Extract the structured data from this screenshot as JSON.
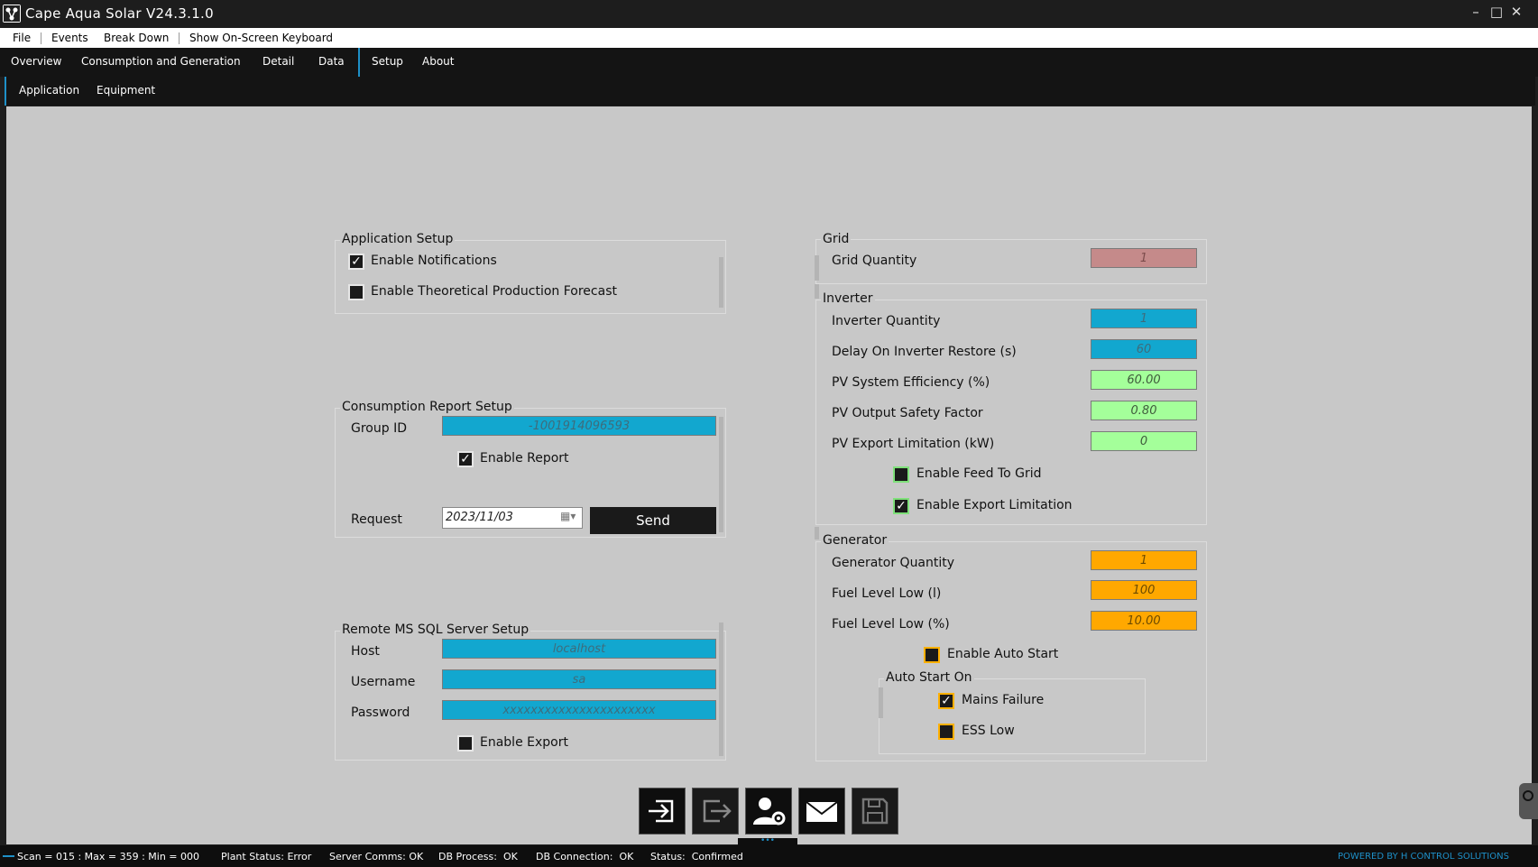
{
  "window": {
    "title": "Cape Aqua Solar V24.3.1.0",
    "minimize": "–",
    "maximize": "□",
    "close": "✕"
  },
  "menu": [
    "File",
    "Events",
    "Break Down",
    "Show On-Screen Keyboard"
  ],
  "tabs": [
    "Overview",
    "Consumption and Generation",
    "Detail",
    "Data",
    "Setup",
    "About"
  ],
  "active_tab": "Setup",
  "subtabs": [
    "Application",
    "Equipment"
  ],
  "application_setup": {
    "title": "Application Setup",
    "enable_notifications": "Enable Notifications",
    "enable_notifications_checked": true,
    "enable_forecast": "Enable Theoretical Production Forecast",
    "enable_forecast_checked": false
  },
  "consumption_report": {
    "title": "Consumption Report Setup",
    "group_id_label": "Group ID",
    "group_id_value": "-1001914096593",
    "enable_report": "Enable Report",
    "enable_report_checked": true,
    "request_label": "Request",
    "request_date": "2023/11/03",
    "send_label": "Send"
  },
  "sql_server": {
    "title": "Remote MS SQL Server Setup",
    "host_label": "Host",
    "host_value": "localhost",
    "username_label": "Username",
    "username_value": "sa",
    "password_label": "Password",
    "password_value": "xxxxxxxxxxxxxxxxxxxxxx",
    "enable_export": "Enable Export",
    "enable_export_checked": false
  },
  "grid": {
    "title": "Grid",
    "quantity_label": "Grid Quantity",
    "quantity_value": "1"
  },
  "inverter": {
    "title": "Inverter",
    "quantity_label": "Inverter Quantity",
    "quantity_value": "1",
    "delay_label": "Delay On Inverter Restore (s)",
    "delay_value": "60",
    "efficiency_label": "PV System Efficiency (%)",
    "efficiency_value": "60.00",
    "safety_label": "PV Output Safety Factor",
    "safety_value": "0.80",
    "export_limit_label": "PV Export Limitation (kW)",
    "export_limit_value": "0",
    "feed_to_grid": "Enable Feed To Grid",
    "feed_to_grid_checked": false,
    "export_limitation": "Enable Export Limitation",
    "export_limitation_checked": true
  },
  "generator": {
    "title": "Generator",
    "quantity_label": "Generator Quantity",
    "quantity_value": "1",
    "fuel_low_l_label": "Fuel Level Low (l)",
    "fuel_low_l_value": "100",
    "fuel_low_pct_label": "Fuel Level Low (%)",
    "fuel_low_pct_value": "10.00",
    "auto_start": "Enable Auto Start",
    "auto_start_checked": false,
    "auto_start_on_title": "Auto Start On",
    "mains_failure": "Mains Failure",
    "mains_failure_checked": true,
    "ess_low": "ESS Low",
    "ess_low_checked": false
  },
  "toolbar": [
    "login-icon",
    "logout-icon",
    "user-settings-icon",
    "mail-icon",
    "save-icon"
  ],
  "status": {
    "scan": "Scan = 015 : Max = 359 : Min = 000",
    "plant": "Plant Status: Error",
    "server": "Server Comms: OK",
    "db_process": "DB Process:  OK",
    "db_connection": "DB Connection:  OK",
    "status": "Status:  Confirmed",
    "powered_by": "POWERED BY H CONTROL SOLUTIONS"
  },
  "colors": {
    "accent": "#1e90c8",
    "blue_field": "#12a7cf",
    "green_field": "#a4ff9a",
    "orange_field": "#ffa800",
    "rose_field": "#c58a8a",
    "background": "#c8c8c8"
  }
}
